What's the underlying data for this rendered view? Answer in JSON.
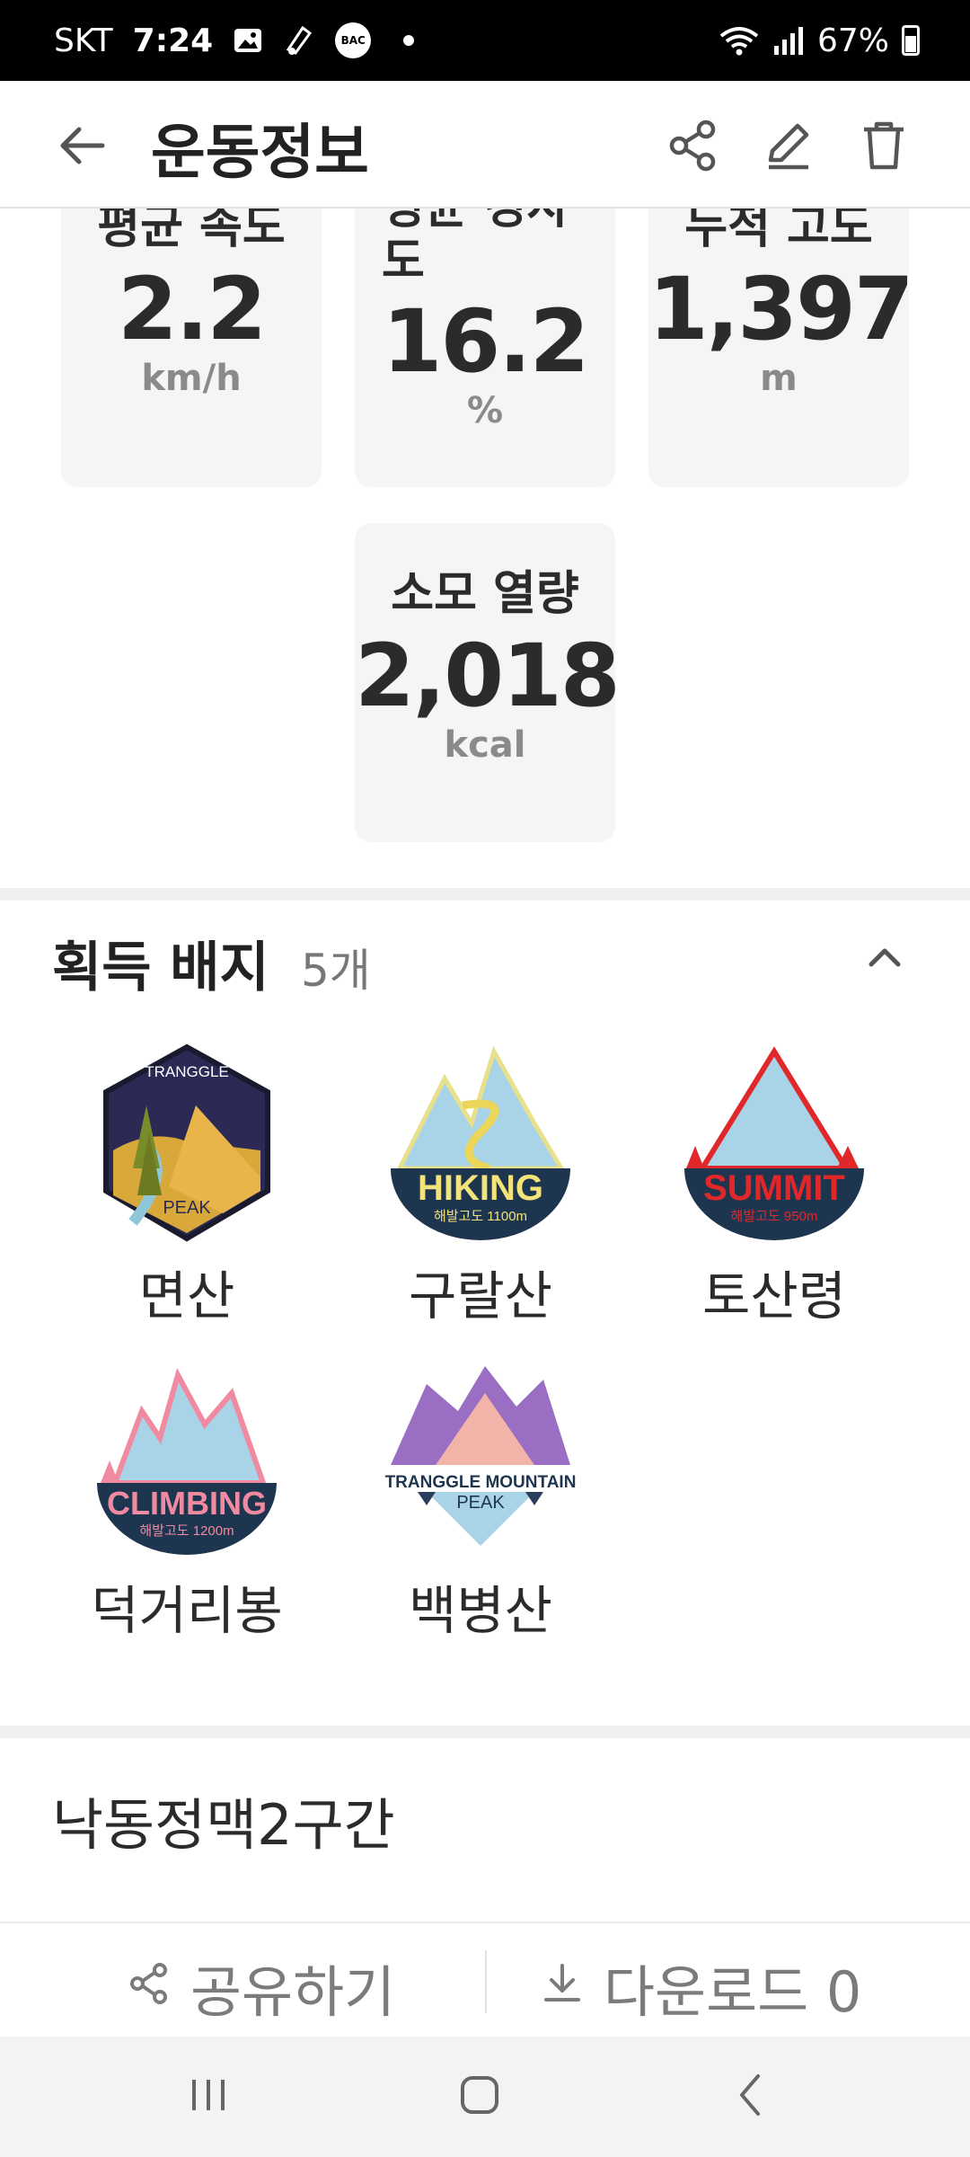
{
  "status_bar": {
    "carrier": "SKT",
    "time": "7:24",
    "bac": "BAC",
    "battery": "67%"
  },
  "header": {
    "title": "운동정보"
  },
  "stats": [
    {
      "label": "평균 속도",
      "value": "2.2",
      "unit": "km/h"
    },
    {
      "label": "평균 경사도",
      "value": "16.2",
      "unit": "%"
    },
    {
      "label": "누적 고도",
      "value": "1,397",
      "unit": "m"
    },
    {
      "label": "소모 열량",
      "value": "2,018",
      "unit": "kcal"
    }
  ],
  "badges": {
    "title": "획득 배지",
    "count": "5개",
    "items": [
      {
        "name": "면산",
        "art_top": "TRANGGLE",
        "art_bottom": "PEAK"
      },
      {
        "name": "구랄산",
        "art_top": "HIKING",
        "art_bottom": "해발고도 1100m"
      },
      {
        "name": "토산령",
        "art_top": "SUMMIT",
        "art_bottom": "해발고도 950m"
      },
      {
        "name": "덕거리봉",
        "art_top": "CLIMBING",
        "art_bottom": "해발고도 1200m"
      },
      {
        "name": "백병산",
        "art_top": "TRANGGLE MOUNTAIN",
        "art_bottom": "PEAK"
      }
    ]
  },
  "route": {
    "name": "낙동정맥2구간"
  },
  "actions": {
    "share_label": "공유하기",
    "download_label": "다운로드 0"
  },
  "icons": [
    "back-arrow-icon",
    "share-icon",
    "edit-icon",
    "trash-icon",
    "chevron-up-icon",
    "download-icon"
  ],
  "colors": {
    "card_bg": "#f5f5f5",
    "divider": "#efefef",
    "badge_navy": "#1e3550"
  }
}
